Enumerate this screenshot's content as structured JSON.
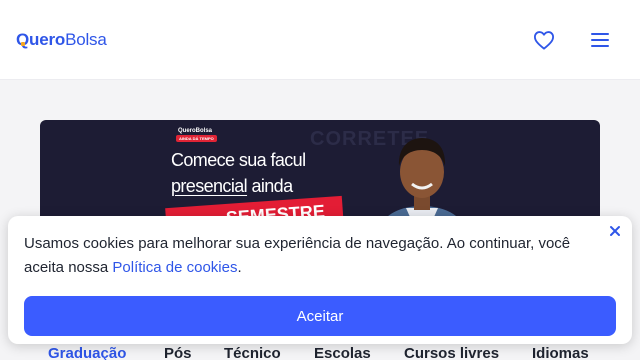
{
  "header": {
    "logo_bold": "Quero",
    "logo_light": "Bolsa",
    "favorites_icon": "heart-icon",
    "menu_icon": "hamburger-menu-icon"
  },
  "banner": {
    "brand": "QueroBolsa",
    "pill": "AINDA DÁ TEMPO",
    "line1": "Comece sua facul",
    "line2_underlined": "presencial",
    "line2_rest": " ainda",
    "highlight": "SEMESTRE",
    "background_text": "CORRETEE"
  },
  "tabs": [
    {
      "label": "Graduação"
    },
    {
      "label": "Pós"
    },
    {
      "label": "Técnico"
    },
    {
      "label": "Escolas"
    },
    {
      "label": "Cursos livres"
    },
    {
      "label": "Idiomas"
    }
  ],
  "cookie": {
    "text_before": "Usamos cookies para melhorar sua experiência de navegação. Ao continuar, você aceita nossa ",
    "link": "Política de cookies",
    "text_after": ".",
    "accept_label": "Aceitar",
    "close_icon": "close-icon"
  },
  "colors": {
    "brand_blue": "#2f56e8",
    "accept_blue": "#3b5cff",
    "banner_bg": "#1d1c34",
    "banner_red": "#e31d35"
  }
}
